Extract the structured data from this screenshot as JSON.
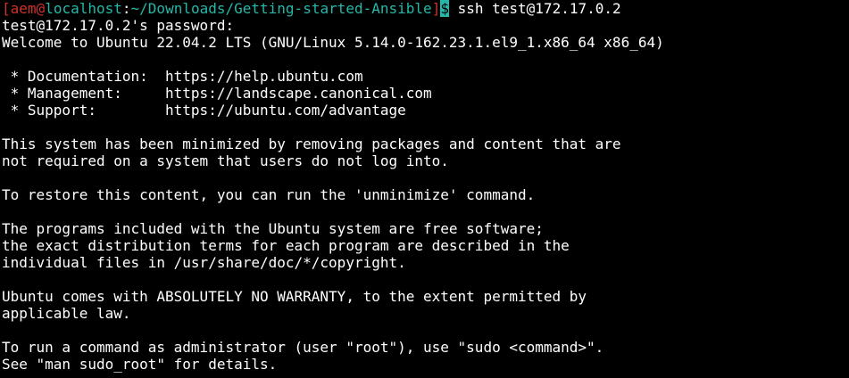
{
  "colors": {
    "background": "#000000",
    "foreground": "#ffffff",
    "prompt_red": "#cd3131",
    "prompt_cyan": "#23b8a9"
  },
  "prompt": {
    "open_bracket": "[",
    "user": "aem",
    "at": "@",
    "host": "localhost",
    "colon": ":",
    "path": "~/Downloads/Getting-started-Ansible",
    "close_bracket": "]",
    "symbol": "$",
    "command": " ssh test@172.17.0.2"
  },
  "output_lines": [
    "test@172.17.0.2's password:",
    "Welcome to Ubuntu 22.04.2 LTS (GNU/Linux 5.14.0-162.23.1.el9_1.x86_64 x86_64)",
    "",
    " * Documentation:  https://help.ubuntu.com",
    " * Management:     https://landscape.canonical.com",
    " * Support:        https://ubuntu.com/advantage",
    "",
    "This system has been minimized by removing packages and content that are",
    "not required on a system that users do not log into.",
    "",
    "To restore this content, you can run the 'unminimize' command.",
    "",
    "The programs included with the Ubuntu system are free software;",
    "the exact distribution terms for each program are described in the",
    "individual files in /usr/share/doc/*/copyright.",
    "",
    "Ubuntu comes with ABSOLUTELY NO WARRANTY, to the extent permitted by",
    "applicable law.",
    "",
    "To run a command as administrator (user \"root\"), use \"sudo <command>\".",
    "See \"man sudo_root\" for details."
  ]
}
